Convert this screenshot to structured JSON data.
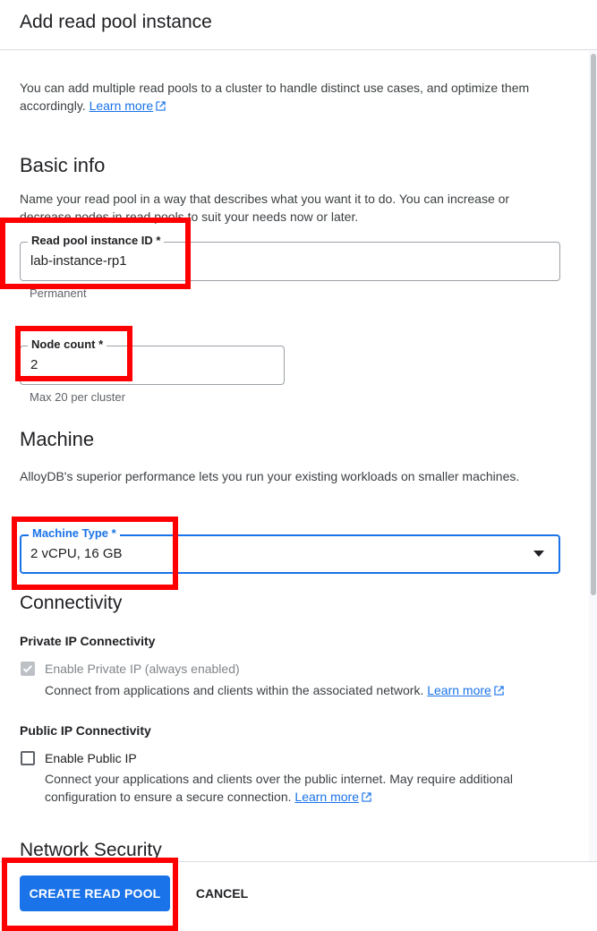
{
  "header": {
    "title": "Add read pool instance"
  },
  "intro": {
    "text": "You can add multiple read pools to a cluster to handle distinct use cases, and optimize them accordingly.",
    "learn_more": "Learn more"
  },
  "basic_info": {
    "title": "Basic info",
    "description": "Name your read pool in a way that describes what you want it to do. You can increase or decrease nodes in read pools to suit your needs now or later.",
    "instance_id": {
      "label": "Read pool instance ID *",
      "value": "lab-instance-rp1",
      "hint": "Permanent"
    },
    "node_count": {
      "label": "Node count *",
      "value": "2",
      "hint": "Max 20 per cluster"
    }
  },
  "machine": {
    "title": "Machine",
    "description": "AlloyDB's superior performance lets you run your existing workloads on smaller machines.",
    "machine_type": {
      "label": "Machine Type *",
      "value": "2 vCPU, 16 GB"
    }
  },
  "connectivity": {
    "title": "Connectivity",
    "private": {
      "title": "Private IP Connectivity",
      "checkbox_label": "Enable Private IP (always enabled)",
      "checked": true,
      "description": "Connect from applications and clients within the associated network.",
      "learn_more": "Learn more"
    },
    "public": {
      "title": "Public IP Connectivity",
      "checkbox_label": "Enable Public IP",
      "checked": false,
      "description": "Connect your applications and clients over the public internet. May require additional configuration to ensure a secure connection.",
      "learn_more": "Learn more"
    }
  },
  "network_security": {
    "title": "Network Security"
  },
  "footer": {
    "create_label": "CREATE READ POOL",
    "cancel_label": "CANCEL"
  },
  "colors": {
    "primary": "#1a73e8",
    "annotation": "#ff0000"
  },
  "icons": {
    "external_link": "external-link-icon",
    "dropdown": "caret-down-icon",
    "check": "check-icon"
  }
}
